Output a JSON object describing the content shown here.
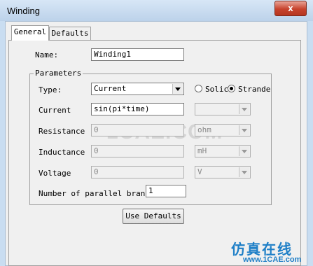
{
  "window": {
    "title": "Winding",
    "close_label": "x"
  },
  "tabs": [
    {
      "label": "General",
      "active": true
    },
    {
      "label": "Defaults",
      "active": false
    }
  ],
  "name": {
    "label": "Name:",
    "value": "Winding1"
  },
  "parameters": {
    "group_label": "Parameters",
    "type": {
      "label": "Type:",
      "value": "Current"
    },
    "radio_solid": {
      "label": "Solic",
      "selected": false
    },
    "radio_stranded": {
      "label": "Strandec",
      "selected": true
    },
    "current": {
      "label": "Current",
      "value": "sin(pi*time)",
      "unit": ""
    },
    "resistance": {
      "label": "Resistance",
      "value": "0",
      "unit": "ohm"
    },
    "inductance": {
      "label": "Inductance",
      "value": "0",
      "unit": "mH"
    },
    "voltage": {
      "label": "Voltage",
      "value": "0",
      "unit": "V"
    },
    "parallel": {
      "label": "Number of parallel branc",
      "value": "1"
    }
  },
  "buttons": {
    "use_defaults": "Use Defaults"
  },
  "watermark": {
    "text": "仿真在线",
    "url": "www.1CAE.com",
    "overlay": "1CAE.COM"
  },
  "colors": {
    "titlebar": "#c9ddf1",
    "close": "#c7432d",
    "watermark": "#1e7fc7"
  }
}
